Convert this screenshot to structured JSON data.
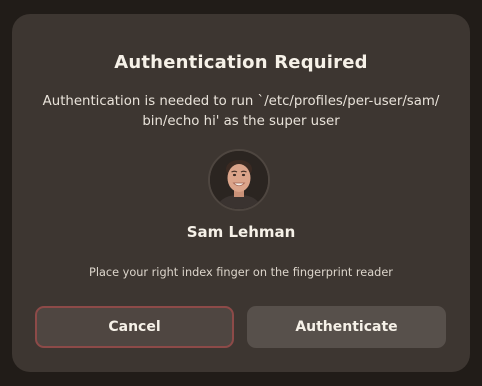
{
  "dialog": {
    "title": "Authentication Required",
    "message_line1": "Authentication is needed to run `/etc/profiles/per-user/sam/",
    "message_line2": "bin/echo hi' as the super user",
    "user": {
      "name": "Sam Lehman",
      "avatar_icon": "user-photo-avatar"
    },
    "hint": "Place your right index finger on the fingerprint reader",
    "buttons": {
      "cancel_label": "Cancel",
      "authenticate_label": "Authenticate"
    }
  },
  "colors": {
    "dialog_background": "#3d3631",
    "page_background": "#211c18",
    "cancel_focus_border": "#8d4a48",
    "button_background": "#57504b",
    "text": "#f6f1e8"
  }
}
